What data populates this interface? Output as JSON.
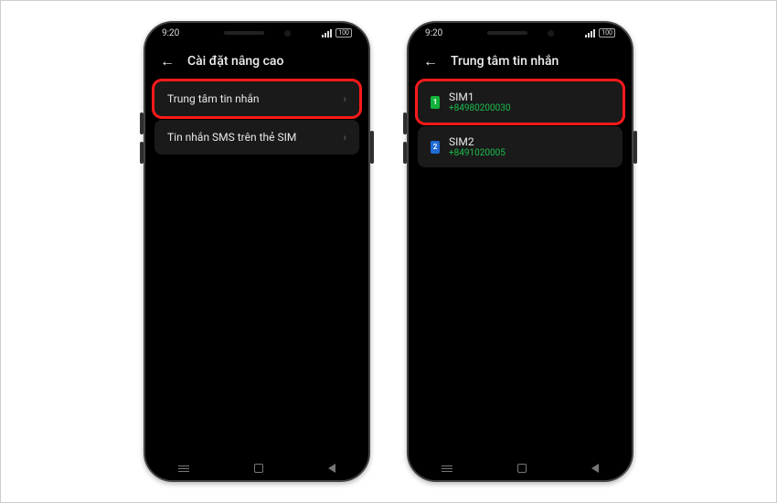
{
  "status": {
    "time": "9:20",
    "battery": "100"
  },
  "phone1": {
    "title": "Cài đặt nâng cao",
    "rows": [
      {
        "label": "Trung tâm tin nhắn"
      },
      {
        "label": "Tin nhắn SMS trên thẻ SIM"
      }
    ]
  },
  "phone2": {
    "title": "Trung tâm tin nhắn",
    "sims": [
      {
        "badge": "1",
        "name": "SIM1",
        "number": "+84980200030"
      },
      {
        "badge": "2",
        "name": "SIM2",
        "number": "+8491020005"
      }
    ]
  }
}
